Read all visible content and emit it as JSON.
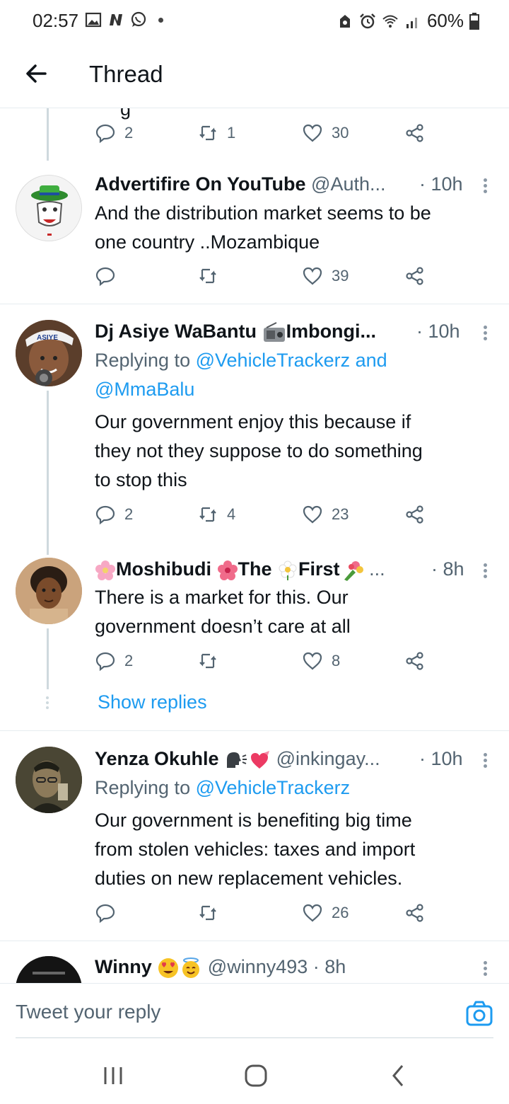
{
  "status_bar": {
    "time": "02:57",
    "battery": "60%"
  },
  "header": {
    "title": "Thread"
  },
  "top_actions": {
    "reply_count": "2",
    "retweet_count": "1",
    "like_count": "30"
  },
  "tweets": [
    {
      "name": "Advertifire On YouTube",
      "handle": "@Auth...",
      "time": "· 10h",
      "text_lines": [
        "And the distribution market seems to be",
        "one country ..Mozambique"
      ],
      "reply_count": "",
      "retweet_count": "",
      "like_count": "39"
    },
    {
      "name": "Dj Asiye WaBantu",
      "name_suffix": "Imbongi...",
      "time": "· 10h",
      "replying_prefix": "Replying to",
      "replying_line1": "@VehicleTrackerz and",
      "replying_line2": "@MmaBalu",
      "text_lines": [
        "Our government enjoy this because if",
        "they not they suppose to do something",
        "to stop this"
      ],
      "reply_count": "2",
      "retweet_count": "4",
      "like_count": "23"
    },
    {
      "name_parts": [
        "Moshibudi",
        "The",
        "First",
        "..."
      ],
      "time": "· 8h",
      "text_lines": [
        "There is a market for this. Our",
        "government doesn’t care at all"
      ],
      "reply_count": "2",
      "retweet_count": "",
      "like_count": "8",
      "show_replies": "Show replies"
    },
    {
      "name": "Yenza Okuhle",
      "handle": "@inkingay...",
      "time": "· 10h",
      "replying_prefix": "Replying to",
      "replying_line1": "@VehicleTrackerz",
      "text_lines": [
        "Our government is benefiting big time",
        "from stolen vehicles: taxes and import",
        "duties on new replacement vehicles."
      ],
      "reply_count": "",
      "retweet_count": "",
      "like_count": "26"
    },
    {
      "name": "Winny",
      "handle": "@winny493",
      "time": "· 8h"
    }
  ],
  "composer": {
    "placeholder": "Tweet your reply"
  },
  "colors": {
    "link": "#1d9bf0",
    "secondary_text": "#536471",
    "divider": "#e6ecf0"
  }
}
